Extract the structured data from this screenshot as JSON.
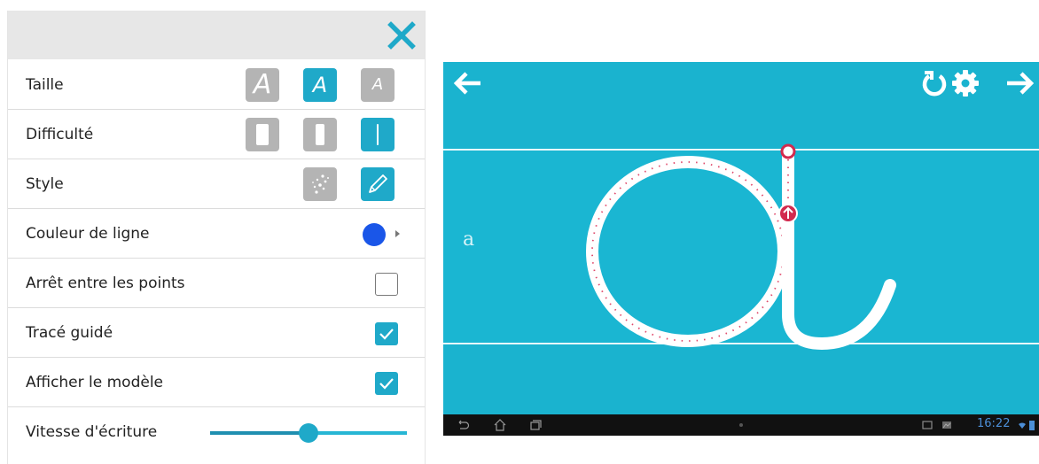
{
  "settings": {
    "rows": {
      "size": {
        "label": "Taille",
        "options": [
          "A",
          "A",
          "A"
        ]
      },
      "difficulty": {
        "label": "Difficulté"
      },
      "style": {
        "label": "Style"
      },
      "line_color": {
        "label": "Couleur de ligne",
        "color": "#1a56e8"
      },
      "stop_between_points": {
        "label": "Arrêt entre les points",
        "checked": false
      },
      "guided_trace": {
        "label": "Tracé guidé",
        "checked": true
      },
      "show_model": {
        "label": "Afficher le modèle",
        "checked": true
      },
      "writing_speed": {
        "label": "Vitesse d'écriture",
        "value_fraction": 0.5
      }
    },
    "accent_color": "#1fa9c9"
  },
  "app": {
    "model_letter": "a",
    "background_color": "#1ab3cf"
  },
  "status_bar": {
    "time": "16:22"
  }
}
